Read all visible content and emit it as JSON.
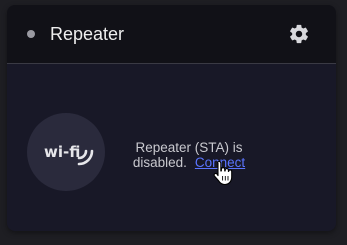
{
  "card": {
    "title": "Repeater",
    "settings_icon": "gear-icon",
    "status_dot_color": "#9a9aa2"
  },
  "status": {
    "icon": "wifi-icon",
    "icon_text": "wi-fi",
    "line1": "Repeater (STA) is",
    "line2_prefix": "disabled.",
    "connect_label": "Connect"
  },
  "colors": {
    "link": "#5a74ff",
    "card_bg": "#181827",
    "header_bg": "#111117"
  }
}
